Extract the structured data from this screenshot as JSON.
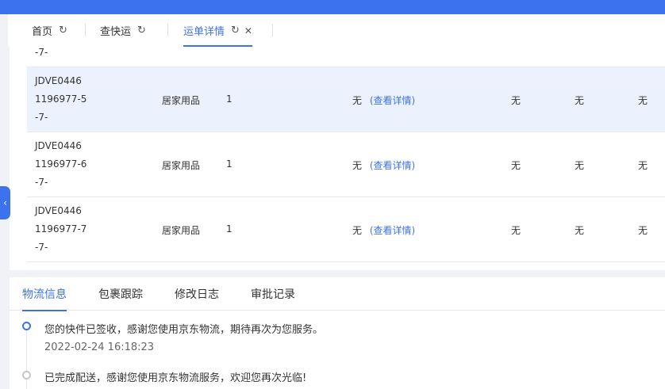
{
  "tabs": [
    {
      "label": "首页",
      "icon": "refresh-icon",
      "closable": false,
      "active": false
    },
    {
      "label": "查快运",
      "icon": "refresh-icon",
      "closable": false,
      "active": false
    },
    {
      "label": "运单详情",
      "icon": "refresh-icon",
      "closable": true,
      "active": true
    }
  ],
  "table": {
    "partial_top_line": "-7-",
    "rows": [
      {
        "code_line1": "JDVE0446",
        "code_line2": "1196977-5",
        "code_line3": "-7-",
        "category": "居家用品",
        "quantity": "1",
        "remark": "无",
        "detail_link": "(查看详情)",
        "col_a": "无",
        "col_b": "无",
        "col_c": "无",
        "highlighted": true
      },
      {
        "code_line1": "JDVE0446",
        "code_line2": "1196977-6",
        "code_line3": "-7-",
        "category": "居家用品",
        "quantity": "1",
        "remark": "无",
        "detail_link": "(查看详情)",
        "col_a": "无",
        "col_b": "无",
        "col_c": "无",
        "highlighted": false
      },
      {
        "code_line1": "JDVE0446",
        "code_line2": "1196977-7",
        "code_line3": "-7-",
        "category": "居家用品",
        "quantity": "1",
        "remark": "无",
        "detail_link": "(查看详情)",
        "col_a": "无",
        "col_b": "无",
        "col_c": "无",
        "highlighted": false
      }
    ]
  },
  "bottom_tabs": [
    {
      "label": "物流信息",
      "active": true
    },
    {
      "label": "包裹跟踪",
      "active": false
    },
    {
      "label": "修改日志",
      "active": false
    },
    {
      "label": "审批记录",
      "active": false
    }
  ],
  "timeline": [
    {
      "text": "您的快件已签收，感谢您使用京东物流，期待再次为您服务。",
      "time": "2022-02-24 16:18:23",
      "current": true
    },
    {
      "text": "已完成配送，感谢您使用京东物流服务，欢迎您再次光临!",
      "time": "",
      "current": false
    }
  ],
  "colors": {
    "accent": "#3d72ef",
    "row_highlight": "#ebf1fd"
  }
}
